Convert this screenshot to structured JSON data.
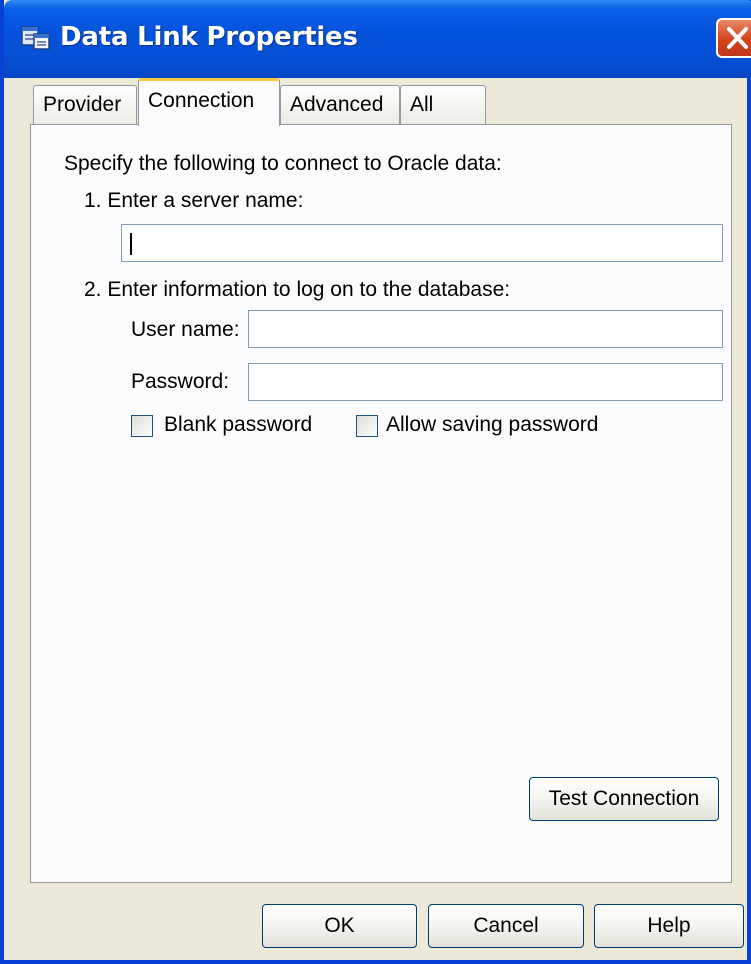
{
  "window": {
    "title": "Data Link Properties"
  },
  "tabs": [
    {
      "label": "Provider",
      "active": false
    },
    {
      "label": "Connection",
      "active": true
    },
    {
      "label": "Advanced",
      "active": false
    },
    {
      "label": "All",
      "active": false
    }
  ],
  "connection": {
    "intro": "Specify the following to connect to Oracle data:",
    "step1_label": "1. Enter a server name:",
    "server_name_value": "",
    "step2_label": "2. Enter information to log on to the database:",
    "username_label": "User name:",
    "username_value": "",
    "password_label": "Password:",
    "password_value": "",
    "blank_password_label": "Blank password",
    "blank_password_checked": false,
    "allow_saving_label": "Allow saving password",
    "allow_saving_checked": false,
    "test_connection_label": "Test Connection"
  },
  "footer": {
    "ok_label": "OK",
    "cancel_label": "Cancel",
    "help_label": "Help"
  },
  "colors": {
    "titlebar": "#0553dc",
    "dialog_bg": "#ece9d8",
    "panel_bg": "#fcfcfe",
    "active_tab_accent": "#ffc83c",
    "close_button": "#d5431b"
  },
  "icons": {
    "title": "data-link-icon",
    "close": "close-icon"
  }
}
